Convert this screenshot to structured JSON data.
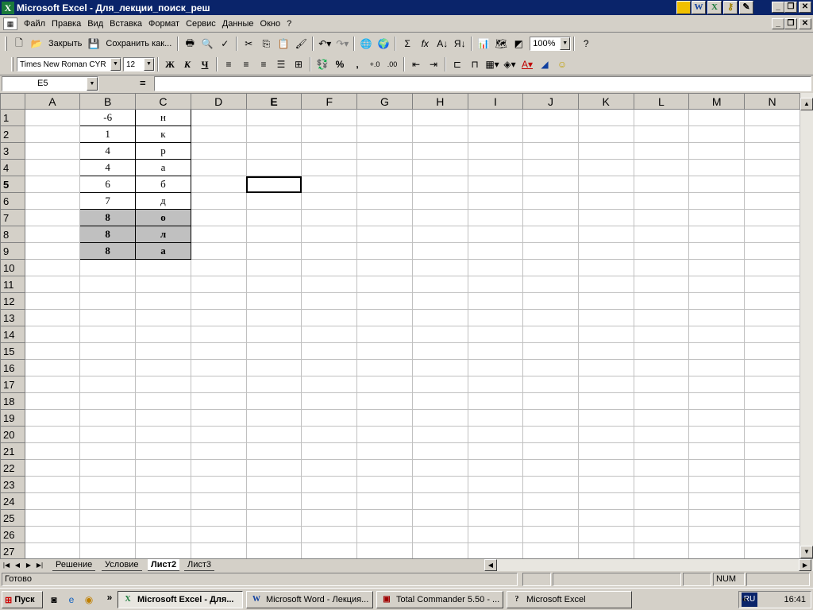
{
  "window": {
    "title": "Microsoft Excel - Для_лекции_поиск_реш",
    "app_icons": [
      "word-icon",
      "excel-icon",
      "key-icon",
      "notes-icon"
    ]
  },
  "menu": [
    "Файл",
    "Правка",
    "Вид",
    "Вставка",
    "Формат",
    "Сервис",
    "Данные",
    "Окно",
    "?"
  ],
  "toolbar1": {
    "close_label": "Закрыть",
    "save_as_label": "Сохранить как...",
    "zoom": "100%"
  },
  "toolbar2": {
    "font": "Times New Roman CYR",
    "size": "12",
    "bold": "Ж",
    "italic": "К",
    "underline": "Ч",
    "percent": "%",
    "comma": ","
  },
  "formula_bar": {
    "name_box": "E5",
    "equals": "=",
    "content": ""
  },
  "sheet": {
    "columns": [
      "A",
      "B",
      "C",
      "D",
      "E",
      "F",
      "G",
      "H",
      "I",
      "J",
      "K",
      "L",
      "M",
      "N"
    ],
    "active_column": "E",
    "active_row": 5,
    "rows": 27,
    "data": [
      {
        "b": "-6",
        "c": "н"
      },
      {
        "b": "1",
        "c": "к"
      },
      {
        "b": "4",
        "c": "р"
      },
      {
        "b": "4",
        "c": "а"
      },
      {
        "b": "6",
        "c": "б"
      },
      {
        "b": "7",
        "c": "д"
      },
      {
        "b": "8",
        "c": "о"
      },
      {
        "b": "8",
        "c": "л"
      },
      {
        "b": "8",
        "c": "а"
      }
    ],
    "highlighted_rows": [
      7,
      8,
      9
    ]
  },
  "tabs": [
    "Решение",
    "Условие",
    "Лист2",
    "Лист3"
  ],
  "active_tab": "Лист2",
  "status": {
    "ready": "Готово",
    "num": "NUM"
  },
  "taskbar": {
    "start": "Пуск",
    "chevron": "»",
    "items": [
      "Microsoft Excel - Для...",
      "Microsoft Word - Лекция...",
      "Total Commander 5.50 - ...",
      "Microsoft Excel"
    ],
    "lang": "RU",
    "tray_chevron": "«",
    "clock": "16:41"
  }
}
